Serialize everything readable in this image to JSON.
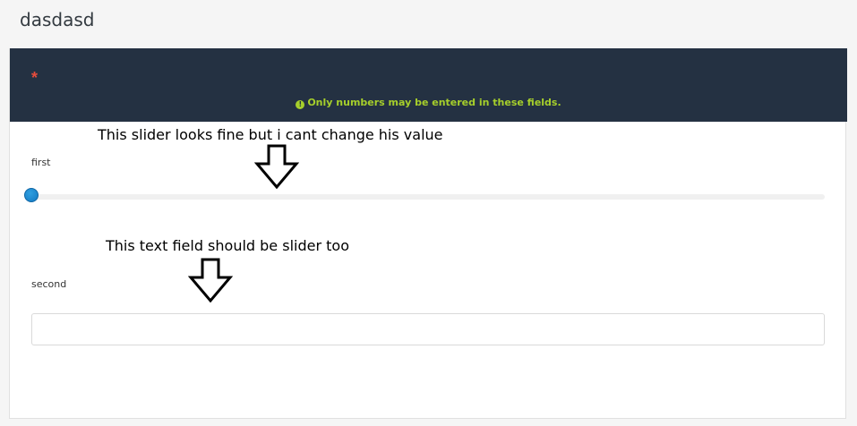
{
  "page": {
    "title": "dasdasd"
  },
  "form": {
    "required_marker": "*",
    "notice_icon": "!",
    "notice_text": "Only numbers may be entered in these fields.",
    "fields": {
      "first": {
        "label": "first",
        "slider_value_fraction": 0
      },
      "second": {
        "label": "second",
        "value": "",
        "placeholder": ""
      }
    }
  },
  "annotations": {
    "slider_note": "This slider looks fine but i cant change his value",
    "textfield_note": "This text field should be slider too"
  },
  "colors": {
    "header_bg": "#243142",
    "notice": "#a6cf2b",
    "required": "#e74c3c",
    "slider_thumb": "#1a85cf"
  },
  "icons": {
    "notice": "exclamation-circle-icon",
    "annotation_arrows": "down-arrow-icon"
  }
}
